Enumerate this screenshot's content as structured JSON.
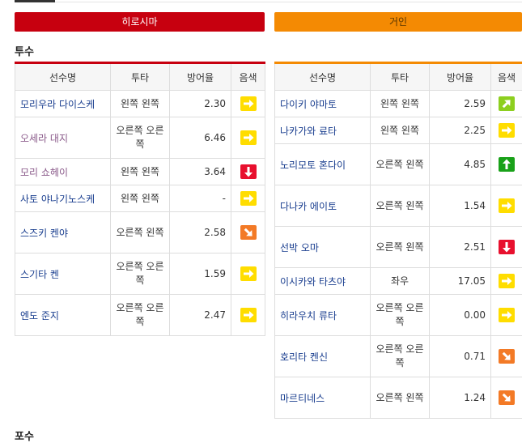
{
  "teams": {
    "left": "히로시마",
    "right": "거인"
  },
  "section": {
    "pitchers": "투수",
    "next": "포수"
  },
  "headers": {
    "name": "선수명",
    "throw": "투타",
    "era": "방어율",
    "symbol": "음색"
  },
  "colors": {
    "right": "#ffdd00",
    "up_right": "#8dcf1f",
    "up": "#19a119",
    "down": "#e8102e",
    "down_right": "#f37a26"
  },
  "left_players": [
    {
      "name": "모리우라 다이스케",
      "throw": "왼쪽 왼쪽",
      "era": "2.30",
      "symbol": "right-arrow-icon"
    },
    {
      "name": "오세라 대지",
      "throw": "오른쪽 오른쪽",
      "era": "6.46",
      "symbol": "right-arrow-icon"
    },
    {
      "name": "모리 쇼헤이",
      "throw": "왼쪽 왼쪽",
      "era": "3.64",
      "symbol": "down-arrow-icon"
    },
    {
      "name": "사토 야나기노스케",
      "throw": "왼쪽 왼쪽",
      "era": "-",
      "symbol": "right-arrow-icon"
    },
    {
      "name": "스즈키 켄야",
      "throw": "오른쪽 왼쪽",
      "era": "2.58",
      "symbol": "down-right-arrow-icon"
    },
    {
      "name": "스기타 켄",
      "throw": "오른쪽 오른쪽",
      "era": "1.59",
      "symbol": "right-arrow-icon"
    },
    {
      "name": "엔도 준지",
      "throw": "오른쪽 오른쪽",
      "era": "2.47",
      "symbol": "right-arrow-icon"
    }
  ],
  "right_players": [
    {
      "name": "다이키 야마토",
      "throw": "왼쪽 왼쪽",
      "era": "2.59",
      "symbol": "up-right-arrow-icon"
    },
    {
      "name": "나카가와 료타",
      "throw": "왼쪽 왼쪽",
      "era": "2.25",
      "symbol": "right-arrow-icon"
    },
    {
      "name": "노리모토 혼다이",
      "throw": "오른쪽 왼쪽",
      "era": "4.85",
      "symbol": "up-arrow-icon"
    },
    {
      "name": "다나카 에이토",
      "throw": "오른쪽 왼쪽",
      "era": "1.54",
      "symbol": "right-arrow-icon"
    },
    {
      "name": "선박 오마",
      "throw": "오른쪽 왼쪽",
      "era": "2.51",
      "symbol": "down-arrow-icon"
    },
    {
      "name": "이시카와 타츠야",
      "throw": "좌우",
      "era": "17.05",
      "symbol": "right-arrow-icon"
    },
    {
      "name": "히라우치 류타",
      "throw": "오른쪽 오른쪽",
      "era": "0.00",
      "symbol": "right-arrow-icon"
    },
    {
      "name": "호리타 켄신",
      "throw": "오른쪽 오른쪽",
      "era": "0.71",
      "symbol": "down-right-arrow-icon"
    },
    {
      "name": "마르티네스",
      "throw": "오른쪽 왼쪽",
      "era": "1.24",
      "symbol": "down-right-arrow-icon"
    }
  ]
}
